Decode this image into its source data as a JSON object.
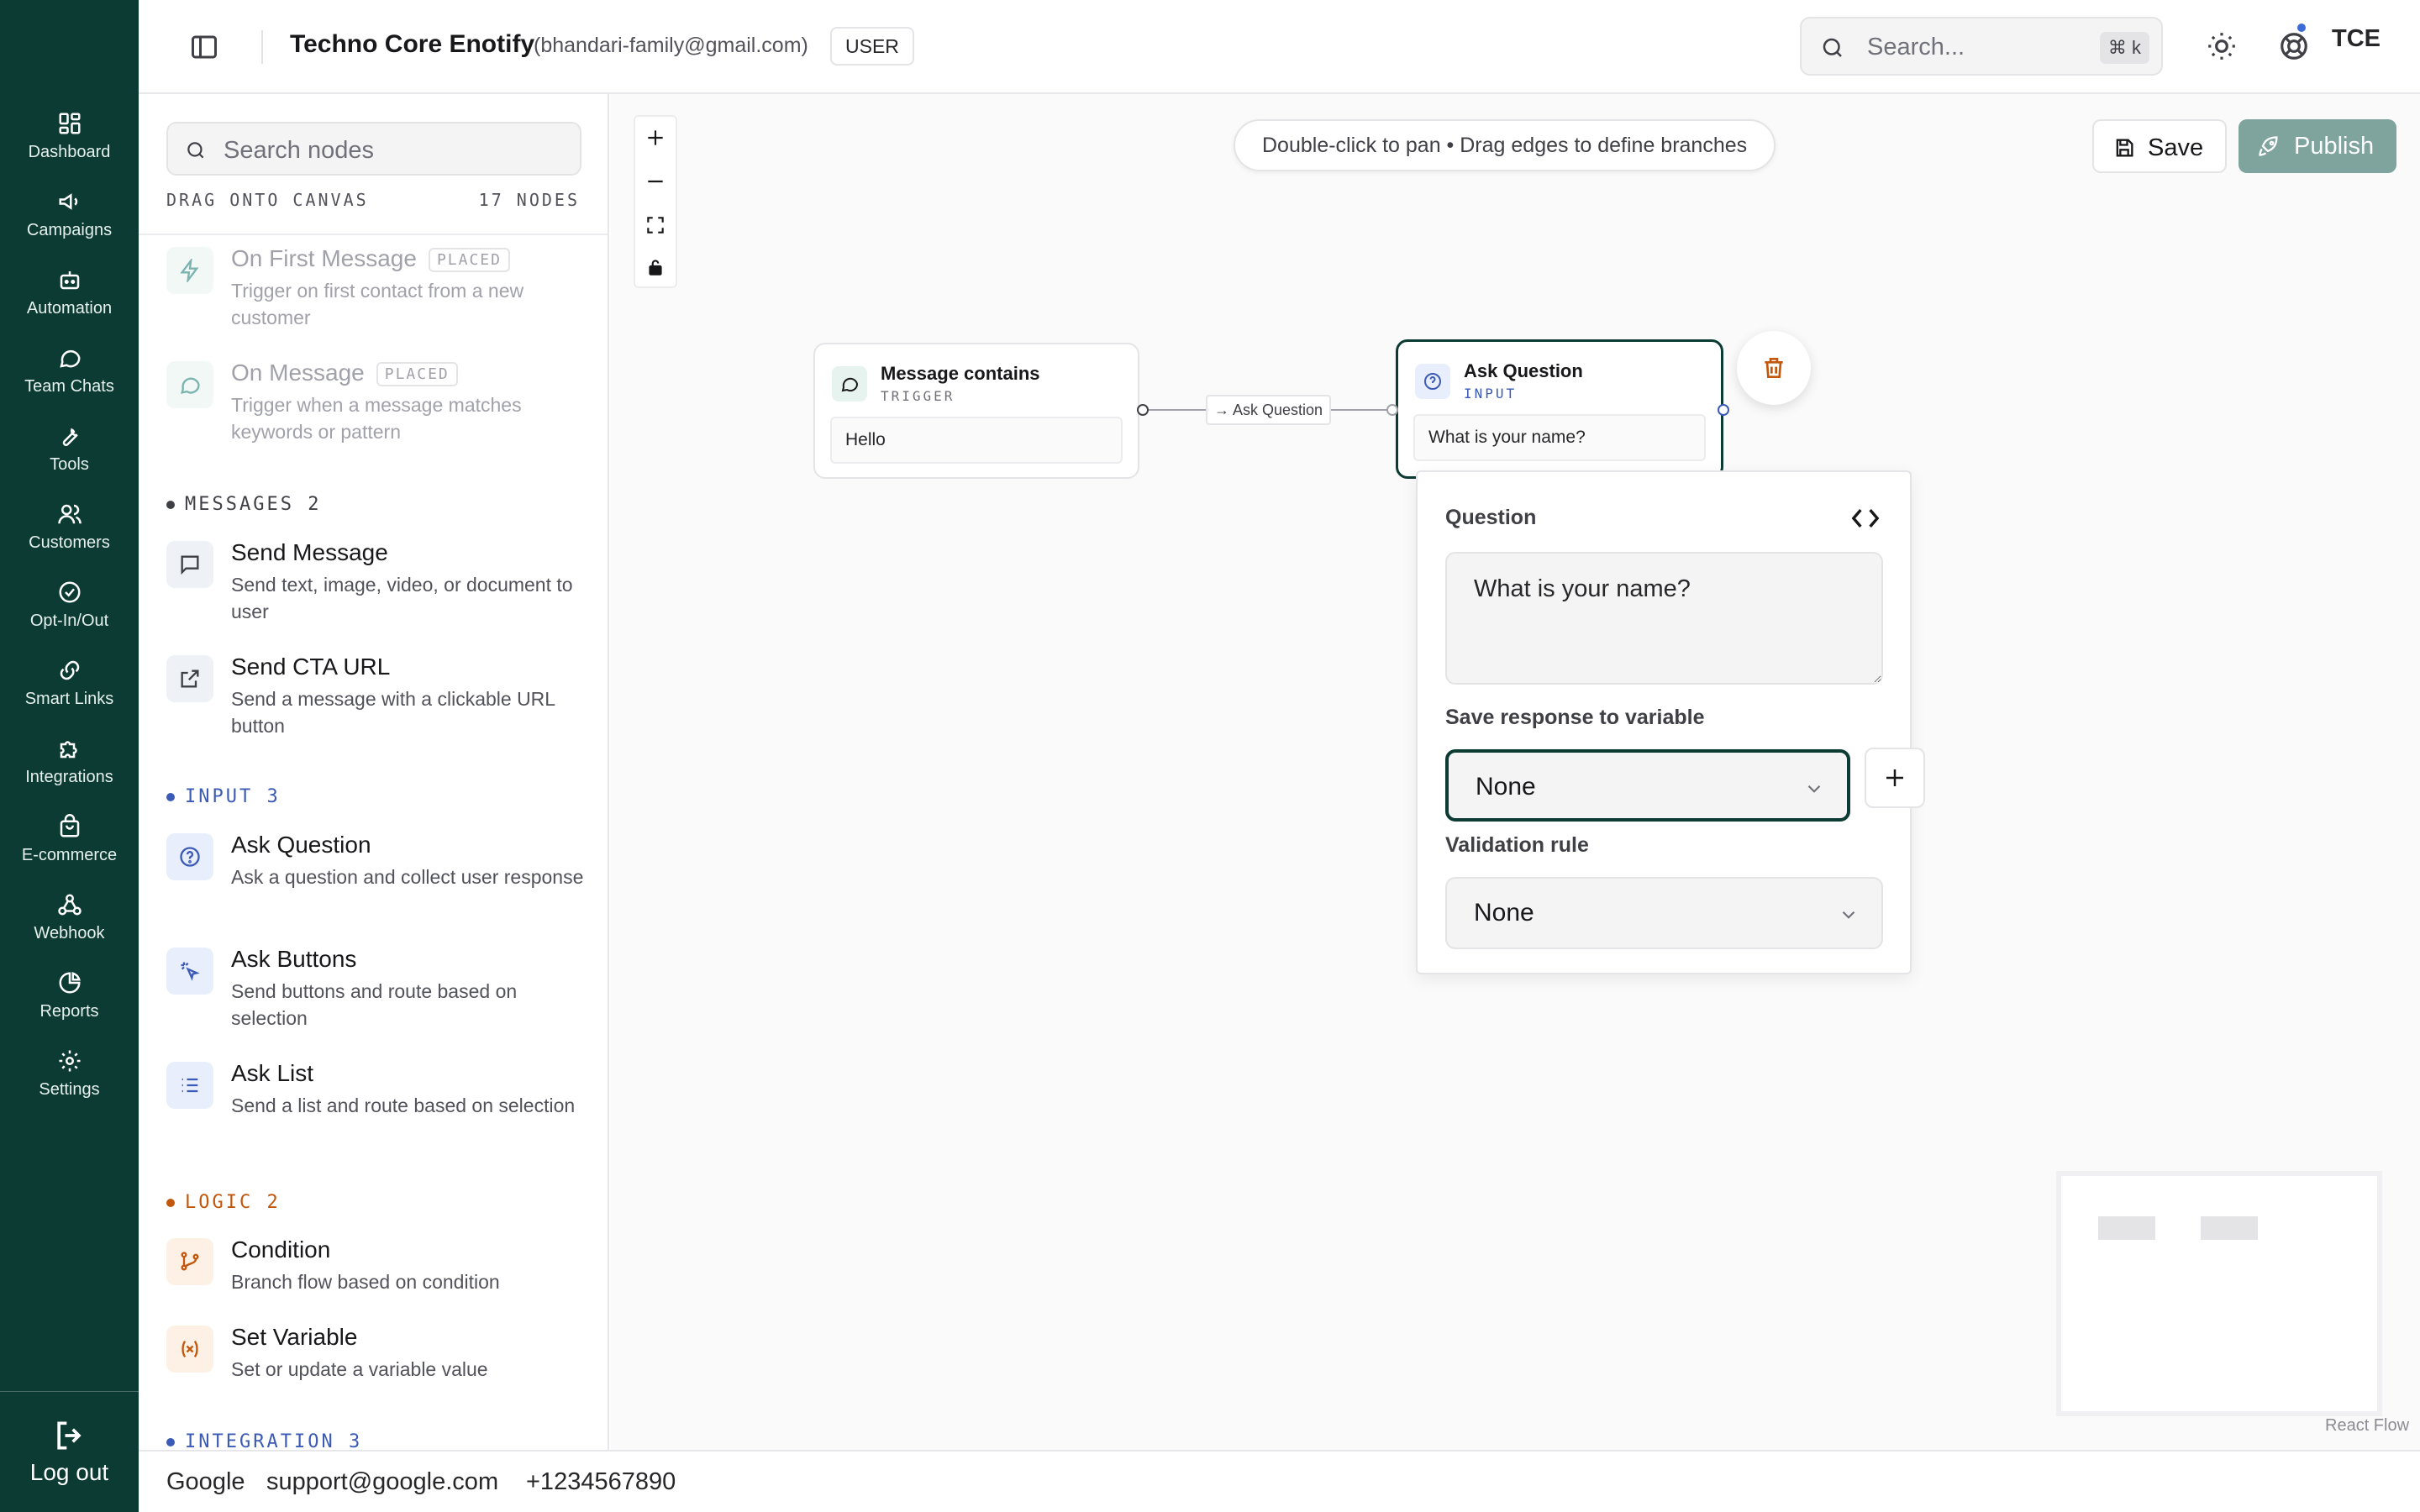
{
  "nav": {
    "items": [
      {
        "label": "Dashboard",
        "icon": "dashboard-icon"
      },
      {
        "label": "Campaigns",
        "icon": "megaphone-icon"
      },
      {
        "label": "Automation",
        "icon": "bot-icon"
      },
      {
        "label": "Team Chats",
        "icon": "chat-bubble-icon"
      },
      {
        "label": "Tools",
        "icon": "wrench-icon"
      },
      {
        "label": "Customers",
        "icon": "users-icon"
      },
      {
        "label": "Opt-In/Out",
        "icon": "check-circle-icon"
      },
      {
        "label": "Smart Links",
        "icon": "link-icon"
      },
      {
        "label": "Integrations",
        "icon": "puzzle-icon"
      },
      {
        "label": "E-commerce",
        "icon": "shopping-bag-icon"
      },
      {
        "label": "Webhook",
        "icon": "webhook-icon"
      },
      {
        "label": "Reports",
        "icon": "pie-chart-icon"
      },
      {
        "label": "Settings",
        "icon": "gear-icon"
      }
    ],
    "logout_label": "Log out"
  },
  "header": {
    "title": "Techno Core Enotify",
    "email": "(bhandari-family@gmail.com)",
    "role": "USER",
    "search_placeholder": "Search...",
    "search_shortcut": "⌘ k",
    "avatar_initials": "TCE",
    "notification_dot_color": "#3b6bd6"
  },
  "palette": {
    "search_placeholder": "Search nodes",
    "drag_hint": "DRAG ONTO CANVAS",
    "node_count": "17 NODES",
    "placed_badge": "PLACED",
    "triggers": [
      {
        "title": "On First Message",
        "desc": "Trigger on first contact from a new customer",
        "placed": true
      },
      {
        "title": "On Message",
        "desc": "Trigger when a message matches keywords or pattern",
        "placed": true
      }
    ],
    "sections": [
      {
        "name": "MESSAGES",
        "count": "2",
        "color": "#3f3f46",
        "items": [
          {
            "title": "Send Message",
            "desc": "Send text, image, video, or document to user"
          },
          {
            "title": "Send CTA URL",
            "desc": "Send a message with a clickable URL button"
          }
        ]
      },
      {
        "name": "INPUT",
        "count": "3",
        "color": "#3b5bb6",
        "items": [
          {
            "title": "Ask Question",
            "desc": "Ask a question and collect user response"
          },
          {
            "title": "Ask Buttons",
            "desc": "Send buttons and route based on selection"
          },
          {
            "title": "Ask List",
            "desc": "Send a list and route based on selection"
          }
        ]
      },
      {
        "name": "LOGIC",
        "count": "2",
        "color": "#c2570c",
        "items": [
          {
            "title": "Condition",
            "desc": "Branch flow based on condition"
          },
          {
            "title": "Set Variable",
            "desc": "Set or update a variable value"
          }
        ]
      },
      {
        "name": "INTEGRATION",
        "count": "3",
        "color": "#3b5bb6",
        "items": []
      }
    ]
  },
  "canvas": {
    "hint": "Double-click to pan • Drag edges to define branches",
    "save_label": "Save",
    "publish_label": "Publish",
    "nodes": {
      "trigger": {
        "title": "Message contains",
        "type": "TRIGGER",
        "body": "Hello"
      },
      "question": {
        "title": "Ask Question",
        "type": "INPUT",
        "body": "What is your name?"
      }
    },
    "edge_label": "→ Ask Question",
    "attribution": "React Flow"
  },
  "properties": {
    "question_label": "Question",
    "question_value": "What is your name?",
    "variable_label": "Save response to variable",
    "variable_value": "None",
    "validation_label": "Validation rule",
    "validation_value": "None"
  },
  "footer": {
    "company": "Google",
    "email": "support@google.com",
    "phone": "+1234567890"
  },
  "colors": {
    "sidebar_bg": "#0c3b34",
    "publish_bg": "#7fa39d",
    "delete_icon": "#c2570c"
  }
}
